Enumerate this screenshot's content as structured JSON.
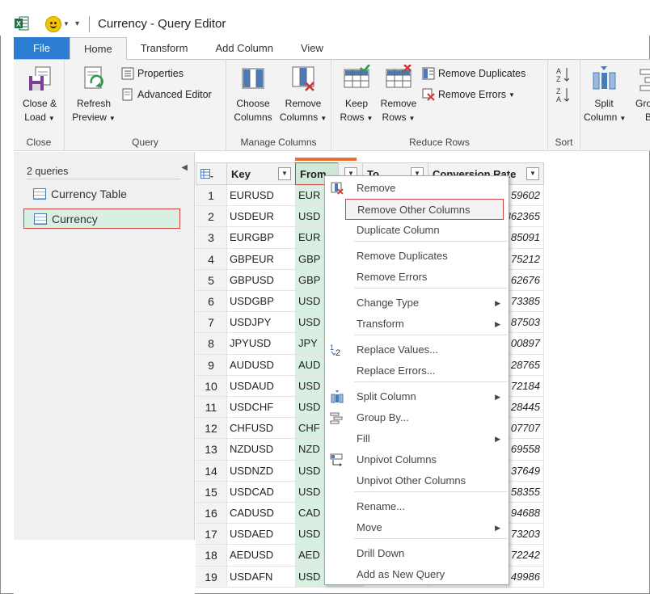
{
  "window": {
    "title": "Currency - Query Editor"
  },
  "tabs": [
    "File",
    "Home",
    "Transform",
    "Add Column",
    "View"
  ],
  "ribbon": {
    "close": {
      "label1": "Close &",
      "label2": "Load",
      "group": "Close"
    },
    "refresh": {
      "label1": "Refresh",
      "label2": "Preview",
      "properties": "Properties",
      "advanced": "Advanced Editor",
      "group": "Query"
    },
    "manage": {
      "choose1": "Choose",
      "choose2": "Columns",
      "remove1": "Remove",
      "remove2": "Columns",
      "group": "Manage Columns"
    },
    "reduce": {
      "keep1": "Keep",
      "keep2": "Rows",
      "remove1": "Remove",
      "remove2": "Rows",
      "dups": "Remove Duplicates",
      "errors": "Remove Errors",
      "group": "Reduce Rows"
    },
    "sort": {
      "group": "Sort"
    },
    "split": {
      "label1": "Split",
      "label2": "Column",
      "group1": "Grou",
      "group2": "By"
    }
  },
  "queries": {
    "header": "2 queries",
    "items": [
      "Currency Table",
      "Currency"
    ]
  },
  "grid": {
    "columns": [
      "Key",
      "From",
      "To",
      "Conversion Rate"
    ],
    "rows": [
      [
        "1",
        "EURUSD",
        "EUR",
        "59602"
      ],
      [
        "2",
        "USDEUR",
        "USD",
        "862365"
      ],
      [
        "3",
        "EURGBP",
        "EUR",
        "85091"
      ],
      [
        "4",
        "GBPEUR",
        "GBP",
        "75212"
      ],
      [
        "5",
        "GBPUSD",
        "GBP",
        "62676"
      ],
      [
        "6",
        "USDGBP",
        "USD",
        "73385"
      ],
      [
        "7",
        "USDJPY",
        "USD",
        "87503"
      ],
      [
        "8",
        "JPYUSD",
        "JPY",
        "00897"
      ],
      [
        "9",
        "AUDUSD",
        "AUD",
        "28765"
      ],
      [
        "10",
        "USDAUD",
        "USD",
        "72184"
      ],
      [
        "11",
        "USDCHF",
        "USD",
        "28445"
      ],
      [
        "12",
        "CHFUSD",
        "CHF",
        "07707"
      ],
      [
        "13",
        "NZDUSD",
        "NZD",
        "69558"
      ],
      [
        "14",
        "USDNZD",
        "USD",
        "37649"
      ],
      [
        "15",
        "USDCAD",
        "USD",
        "58355"
      ],
      [
        "16",
        "CADUSD",
        "CAD",
        "94688"
      ],
      [
        "17",
        "USDAED",
        "USD",
        "73203"
      ],
      [
        "18",
        "AEDUSD",
        "AED",
        "72242"
      ],
      [
        "19",
        "USDAFN",
        "USD",
        "49986"
      ]
    ]
  },
  "menu": {
    "items": [
      "Remove",
      "Remove Other Columns",
      "Duplicate Column",
      "Remove Duplicates",
      "Remove Errors",
      "Change Type",
      "Transform",
      "Replace Values...",
      "Replace Errors...",
      "Split Column",
      "Group By...",
      "Fill",
      "Unpivot Columns",
      "Unpivot Other Columns",
      "Rename...",
      "Move",
      "Drill Down",
      "Add as New Query"
    ]
  }
}
